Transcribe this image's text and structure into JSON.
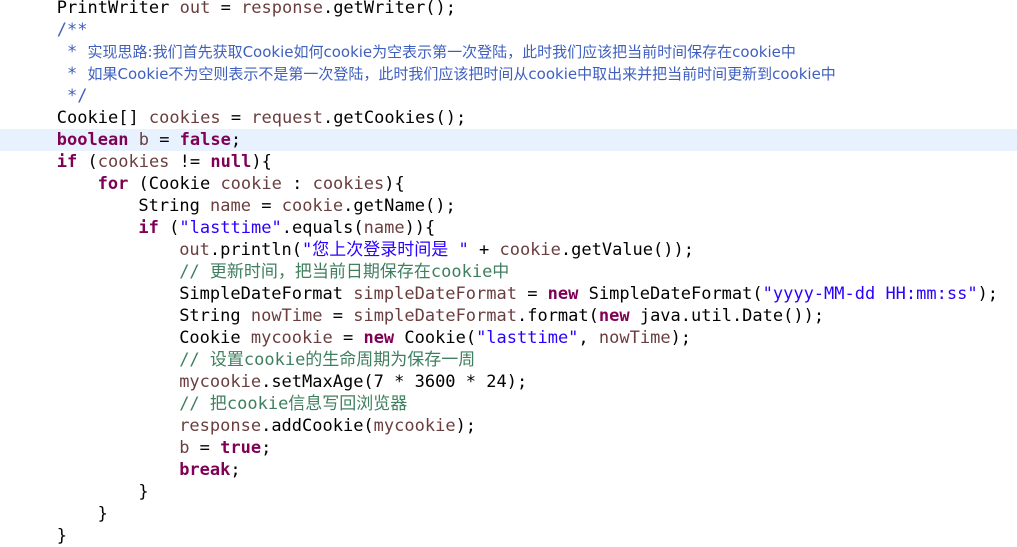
{
  "editor": {
    "current_line": 6,
    "colors": {
      "keyword": "#7f0055",
      "string": "#2a00ff",
      "comment": "#3f7f5f",
      "javadoc": "#3f5fbf",
      "local_variable": "#6a3e3e",
      "current_line_highlight": "#e8f2fe"
    },
    "lines": [
      {
        "indent": 4,
        "tokens": [
          {
            "t": "PrintWriter "
          },
          {
            "t": "out",
            "c": "var"
          },
          {
            "t": " = "
          },
          {
            "t": "response",
            "c": "var"
          },
          {
            "t": ".getWriter();"
          }
        ]
      },
      {
        "indent": 4,
        "tokens": [
          {
            "t": "/**",
            "c": "jd"
          }
        ]
      },
      {
        "indent": 4,
        "tokens": [
          {
            "t": " * ",
            "c": "jd"
          },
          {
            "t": "实现思路:我们首先获取Cookie如何cookie为空表示第一次登陆，此时我们应该把当前时间保存在cookie中",
            "c": "jdc"
          }
        ]
      },
      {
        "indent": 4,
        "tokens": [
          {
            "t": " * ",
            "c": "jd"
          },
          {
            "t": "如果Cookie不为空则表示不是第一次登陆，此时我们应该把时间从cookie中取出来并把当前时间更新到cookie中",
            "c": "jdc"
          }
        ]
      },
      {
        "indent": 4,
        "tokens": [
          {
            "t": " */",
            "c": "jd"
          }
        ]
      },
      {
        "indent": 4,
        "tokens": [
          {
            "t": "Cookie[] "
          },
          {
            "t": "cookies",
            "c": "var"
          },
          {
            "t": " = "
          },
          {
            "t": "request",
            "c": "var"
          },
          {
            "t": ".getCookies();"
          }
        ]
      },
      {
        "indent": 4,
        "tokens": [
          {
            "t": "boolean",
            "c": "kw"
          },
          {
            "t": " "
          },
          {
            "t": "b",
            "c": "var"
          },
          {
            "t": " = "
          },
          {
            "t": "false",
            "c": "kw"
          },
          {
            "t": ";"
          }
        ]
      },
      {
        "indent": 4,
        "tokens": [
          {
            "t": "if",
            "c": "kw"
          },
          {
            "t": " ("
          },
          {
            "t": "cookies",
            "c": "var"
          },
          {
            "t": " != "
          },
          {
            "t": "null",
            "c": "kw"
          },
          {
            "t": "){"
          }
        ]
      },
      {
        "indent": 8,
        "tokens": [
          {
            "t": "for",
            "c": "kw"
          },
          {
            "t": " (Cookie "
          },
          {
            "t": "cookie",
            "c": "var"
          },
          {
            "t": " : "
          },
          {
            "t": "cookies",
            "c": "var"
          },
          {
            "t": "){"
          }
        ]
      },
      {
        "indent": 12,
        "tokens": [
          {
            "t": "String "
          },
          {
            "t": "name",
            "c": "var"
          },
          {
            "t": " = "
          },
          {
            "t": "cookie",
            "c": "var"
          },
          {
            "t": ".getName();"
          }
        ]
      },
      {
        "indent": 12,
        "tokens": [
          {
            "t": "if",
            "c": "kw"
          },
          {
            "t": " ("
          },
          {
            "t": "\"lasttime\"",
            "c": "str"
          },
          {
            "t": ".equals("
          },
          {
            "t": "name",
            "c": "var"
          },
          {
            "t": ")){"
          }
        ]
      },
      {
        "indent": 16,
        "tokens": [
          {
            "t": "out",
            "c": "var"
          },
          {
            "t": ".println("
          },
          {
            "t": "\"您上次登录时间是 \"",
            "c": "str"
          },
          {
            "t": " + "
          },
          {
            "t": "cookie",
            "c": "var"
          },
          {
            "t": ".getValue());"
          }
        ]
      },
      {
        "indent": 16,
        "tokens": [
          {
            "t": "// 更新时间，把当前日期保存在cookie中",
            "c": "cm"
          }
        ]
      },
      {
        "indent": 16,
        "tokens": [
          {
            "t": "SimpleDateFormat "
          },
          {
            "t": "simpleDateFormat",
            "c": "var"
          },
          {
            "t": " = "
          },
          {
            "t": "new",
            "c": "kw"
          },
          {
            "t": " SimpleDateFormat("
          },
          {
            "t": "\"yyyy-MM-dd HH:mm:ss\"",
            "c": "str"
          },
          {
            "t": ");"
          }
        ]
      },
      {
        "indent": 16,
        "tokens": [
          {
            "t": "String "
          },
          {
            "t": "nowTime",
            "c": "var"
          },
          {
            "t": " = "
          },
          {
            "t": "simpleDateFormat",
            "c": "var"
          },
          {
            "t": ".format("
          },
          {
            "t": "new",
            "c": "kw"
          },
          {
            "t": " java.util.Date());"
          }
        ]
      },
      {
        "indent": 16,
        "tokens": [
          {
            "t": "Cookie "
          },
          {
            "t": "mycookie",
            "c": "var"
          },
          {
            "t": " = "
          },
          {
            "t": "new",
            "c": "kw"
          },
          {
            "t": " Cookie("
          },
          {
            "t": "\"lasttime\"",
            "c": "str"
          },
          {
            "t": ", "
          },
          {
            "t": "nowTime",
            "c": "var"
          },
          {
            "t": ");"
          }
        ]
      },
      {
        "indent": 16,
        "tokens": [
          {
            "t": "// 设置cookie的生命周期为保存一周",
            "c": "cm"
          }
        ]
      },
      {
        "indent": 16,
        "tokens": [
          {
            "t": "mycookie",
            "c": "var"
          },
          {
            "t": ".setMaxAge(7 * 3600 * 24);"
          }
        ]
      },
      {
        "indent": 16,
        "tokens": [
          {
            "t": "// 把cookie信息写回浏览器",
            "c": "cm"
          }
        ]
      },
      {
        "indent": 16,
        "tokens": [
          {
            "t": "response",
            "c": "var"
          },
          {
            "t": ".addCookie("
          },
          {
            "t": "mycookie",
            "c": "var"
          },
          {
            "t": ");"
          }
        ]
      },
      {
        "indent": 16,
        "tokens": [
          {
            "t": "b",
            "c": "var"
          },
          {
            "t": " = "
          },
          {
            "t": "true",
            "c": "kw"
          },
          {
            "t": ";"
          }
        ]
      },
      {
        "indent": 16,
        "tokens": [
          {
            "t": "break",
            "c": "kw"
          },
          {
            "t": ";"
          }
        ]
      },
      {
        "indent": 12,
        "tokens": [
          {
            "t": "}"
          }
        ]
      },
      {
        "indent": 8,
        "tokens": [
          {
            "t": "}"
          }
        ]
      },
      {
        "indent": 4,
        "tokens": [
          {
            "t": "}"
          }
        ]
      }
    ]
  }
}
